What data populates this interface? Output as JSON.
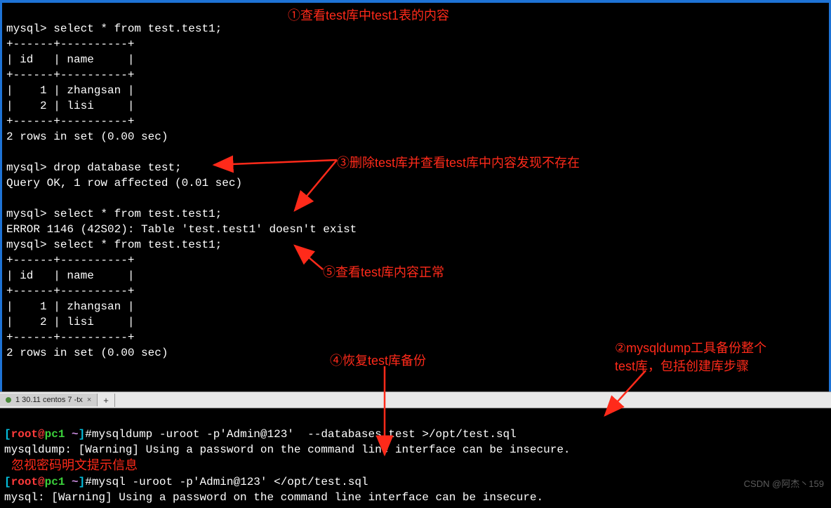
{
  "top": {
    "lines": [
      "mysql> select * from test.test1;",
      "+------+----------+",
      "| id   | name     |",
      "+------+----------+",
      "|    1 | zhangsan |",
      "|    2 | lisi     |",
      "+------+----------+",
      "2 rows in set (0.00 sec)",
      "",
      "mysql> drop database test;",
      "Query OK, 1 row affected (0.01 sec)",
      "",
      "mysql> select * from test.test1;",
      "ERROR 1146 (42S02): Table 'test.test1' doesn't exist",
      "mysql> select * from test.test1;",
      "+------+----------+",
      "| id   | name     |",
      "+------+----------+",
      "|    1 | zhangsan |",
      "|    2 | lisi     |",
      "+------+----------+",
      "2 rows in set (0.00 sec)"
    ]
  },
  "tabstrip": {
    "tab_label": "1 30.11 centos 7 -tx",
    "add": "+"
  },
  "bottom": {
    "prompt_open": "[",
    "prompt_user": "root",
    "prompt_at": "@",
    "prompt_host": "pc1 ",
    "prompt_tilde": "~",
    "prompt_close": "]",
    "prompt_hash": "#",
    "cmd1": "mysqldump -uroot -p'Admin@123'  --databases test >/opt/test.sql",
    "warn1": "mysqldump: [Warning] Using a password on the command line interface can be insecure.",
    "red_note": "忽视密码明文提示信息",
    "cmd2": "mysql -uroot -p'Admin@123' </opt/test.sql",
    "warn2": "mysql: [Warning] Using a password on the command line interface can be insecure."
  },
  "annotations": {
    "a1": "①查看test库中test1表的内容",
    "a2_l1": "②mysqldump工具备份整个",
    "a2_l2": "test库，包括创建库步骤",
    "a3": "③删除test库并查看test库中内容发现不存在",
    "a4": "④恢复test库备份",
    "a5": "⑤查看test库内容正常"
  },
  "watermark": "CSDN @阿杰丶159"
}
